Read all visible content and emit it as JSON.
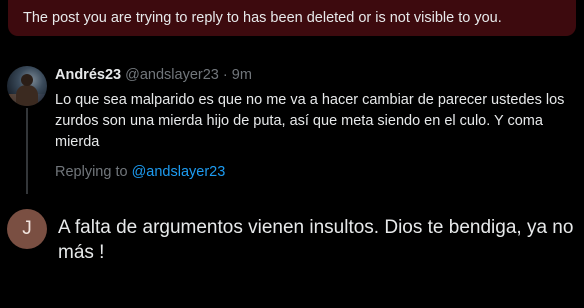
{
  "banner": {
    "message": "The post you are trying to reply to has been deleted or is not visible to you."
  },
  "tweet": {
    "display_name": "Andrés23",
    "handle": "@andslayer23",
    "separator": "·",
    "time": "9m",
    "body": "Lo que sea malparido es que no me va a hacer cambiar de parecer ustedes los zurdos son una mierda hijo de puta, así que meta siendo en el culo. Y coma mierda",
    "replying_prefix": "Replying to",
    "replying_handle": "@andslayer23"
  },
  "composer": {
    "avatar_initial": "J",
    "text": "A falta de argumentos vienen insultos. Dios te bendiga, ya no más !"
  },
  "colors": {
    "banner_bg": "#3d0a0e",
    "link": "#1d9bf0",
    "muted": "#71767b",
    "avatar_bg": "#7a4f42"
  }
}
